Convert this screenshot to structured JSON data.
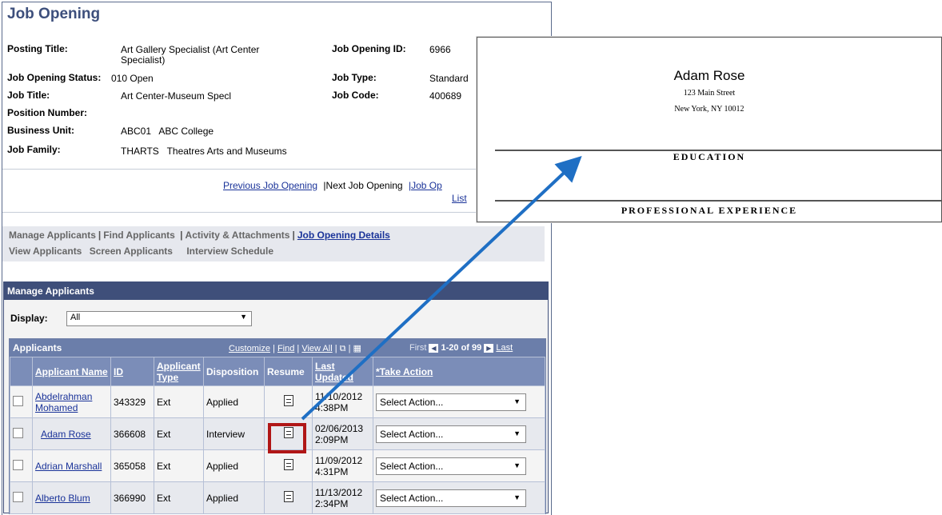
{
  "page_title": "Job Opening",
  "fields": {
    "posting_title_label": "Posting Title:",
    "posting_title_value_1": "Art Gallery Specialist (Art Center",
    "posting_title_value_2": "Specialist)",
    "job_opening_id_label": "Job Opening ID:",
    "job_opening_id_value": "6966",
    "status_label": "Job Opening Status:",
    "status_value": "010 Open",
    "job_type_label": "Job Type:",
    "job_type_value": "Standard",
    "job_title_label": "Job Title:",
    "job_title_value": "Art Center-Museum Specl",
    "job_code_label": "Job Code:",
    "job_code_value": "400689",
    "position_number_label": "Position Number:",
    "business_unit_label": "Business Unit:",
    "business_unit_value": "ABC01   ABC College",
    "job_family_label": "Job Family:",
    "job_family_value": "THARTS   Theatres Arts and Museums"
  },
  "job_nav": {
    "previous": "Previous Job Opening",
    "next": "|Next Job Opening",
    "list_prefix": "|Job Op",
    "list_suffix": "List"
  },
  "tabs": {
    "manage": "Manage Applicants",
    "find": "Find Applicants",
    "activity": "Activity & Attachments",
    "details": "Job Opening Details",
    "view": "View Applicants",
    "screen": "Screen Applicants",
    "interview": "Interview Schedule"
  },
  "manage": {
    "header": "Manage Applicants",
    "display_label": "Display:",
    "display_value": "All"
  },
  "grid": {
    "title": "Applicants",
    "customize": "Customize",
    "find": "Find",
    "view_all": "View All",
    "first": "First",
    "range": "1-20 of 99",
    "last": "Last",
    "columns": {
      "name": "Applicant Name",
      "id": "ID",
      "type": "Applicant Type",
      "disposition": "Disposition",
      "resume": "Resume",
      "updated": "Last Updated",
      "action": "*Take Action"
    },
    "rows": [
      {
        "name": "Abdelrahman Mohamed",
        "id": "343329",
        "type": "Ext",
        "disposition": "Applied",
        "date": "11/10/2012",
        "time": "4:38PM",
        "action": "Select Action..."
      },
      {
        "name": "Adam Rose",
        "id": "366608",
        "type": "Ext",
        "disposition": "Interview",
        "date": "02/06/2013",
        "time": "2:09PM",
        "action": "Select Action..."
      },
      {
        "name": "Adrian Marshall",
        "id": "365058",
        "type": "Ext",
        "disposition": "Applied",
        "date": "11/09/2012",
        "time": "4:31PM",
        "action": "Select Action..."
      },
      {
        "name": "Alberto Blum",
        "id": "366990",
        "type": "Ext",
        "disposition": "Applied",
        "date": "11/13/2012",
        "time": "2:34PM",
        "action": "Select Action..."
      }
    ]
  },
  "resume": {
    "name": "Adam Rose",
    "street": "123 Main Street",
    "city": "New York, NY 10012",
    "section_education": "EDUCATION",
    "section_experience": "PROFESSIONAL EXPERIENCE"
  },
  "colors": {
    "title": "#3d4f7c",
    "link": "#1a3399",
    "highlight": "#b01616",
    "arrow": "#1f6fc4"
  }
}
